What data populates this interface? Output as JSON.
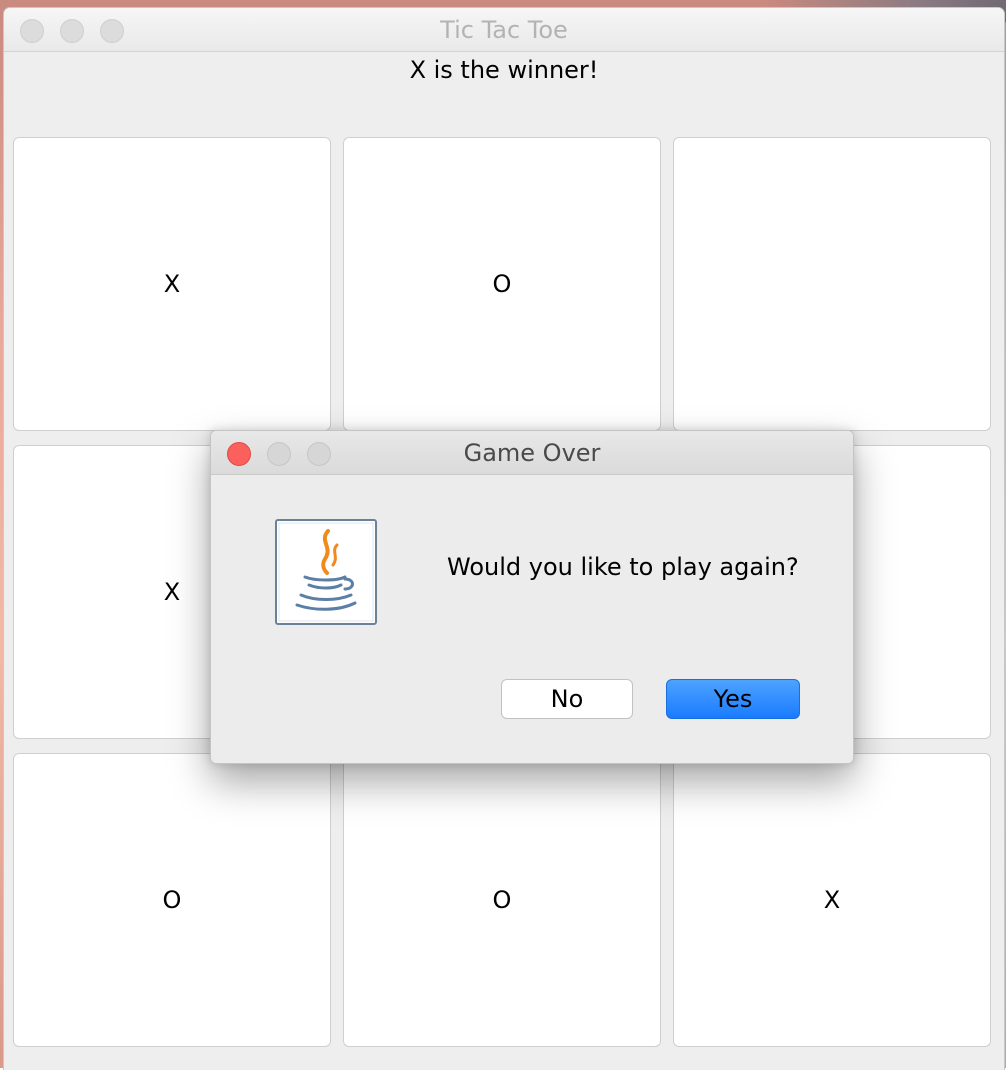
{
  "window": {
    "title": "Tic Tac Toe"
  },
  "status": {
    "text": "X is the winner!"
  },
  "board": {
    "cells": [
      "X",
      "O",
      "",
      "X",
      "",
      "",
      "O",
      "O",
      "X"
    ]
  },
  "dialog": {
    "title": "Game Over",
    "message": "Would you like to play again?",
    "icon": "java-icon",
    "buttons": {
      "no_label": "No",
      "yes_label": "Yes"
    }
  },
  "colors": {
    "close_button": "#fc605c",
    "default_button": "#1a7bff"
  }
}
